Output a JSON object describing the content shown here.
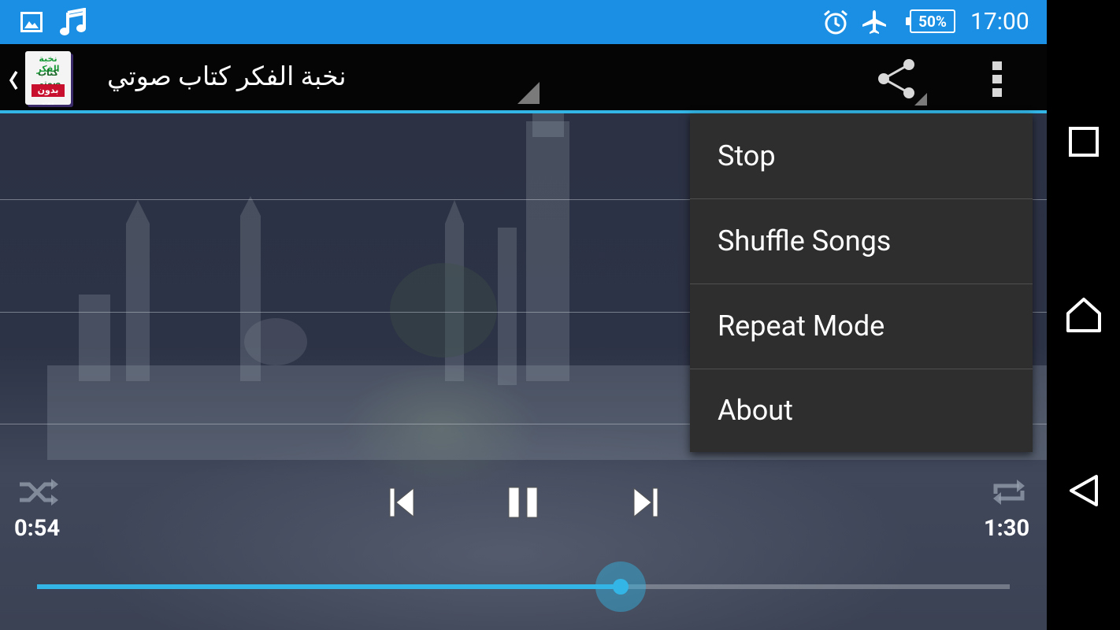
{
  "status_bar": {
    "time": "17:00",
    "battery": "50%",
    "left_icons": [
      "image-icon",
      "music-note-icon"
    ],
    "right_icons": [
      "alarm-icon",
      "airplane-icon",
      "battery-icon"
    ],
    "background": "#1a8fe3"
  },
  "action_bar": {
    "title": "نخبة الفكر كتاب صوتي",
    "app_icon_lines": [
      "نخبة الفكر",
      "كتاب صوتي",
      "بدون نت"
    ],
    "accent": "#33b5e5"
  },
  "menu": {
    "items": [
      {
        "label": "Stop"
      },
      {
        "label": "Shuffle Songs"
      },
      {
        "label": "Repeat Mode"
      },
      {
        "label": "About"
      }
    ]
  },
  "player": {
    "elapsed": "0:54",
    "duration": "1:30",
    "progress": 0.6,
    "state": "playing"
  },
  "nav_bar": {
    "buttons": [
      "recents-button",
      "home-button",
      "back-button"
    ]
  }
}
